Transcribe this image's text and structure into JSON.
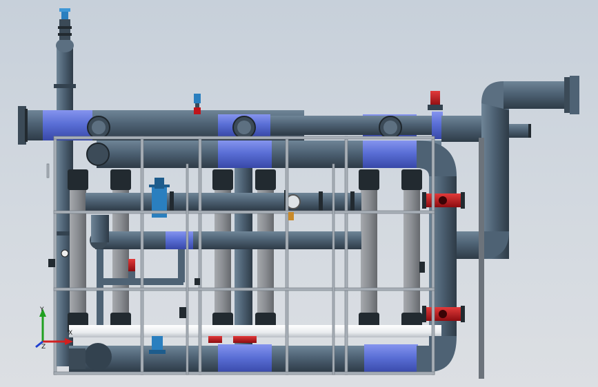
{
  "view": {
    "background_top": "#c7d0da",
    "background_bottom": "#dcdfe3"
  },
  "colors": {
    "pipe": "#4e6274",
    "pipe_dark": "#33424f",
    "pipe_highlight": "#6f8597",
    "pipe_blue_band": "#5a6fd6",
    "membrane_tube": "#8a8d92",
    "frame": "#a9b0b8",
    "frame_dark": "#6c737b",
    "valve_red": "#c0141a",
    "valve_blue": "#2a7fbf",
    "white_pipe": "#eef0f2",
    "coupling": "#222a30"
  },
  "axis_triad": {
    "x_label": "X",
    "y_label": "Y",
    "z_label": "Z",
    "x_color": "#d22020",
    "y_color": "#20a020",
    "z_color": "#2040d0"
  },
  "model": {
    "trains": 3,
    "membrane_modules_per_train": 2,
    "components": [
      "main-header",
      "return-header",
      "membrane-module",
      "butterfly-valve",
      "air-release-valve",
      "support-frame",
      "permeate-line"
    ]
  }
}
